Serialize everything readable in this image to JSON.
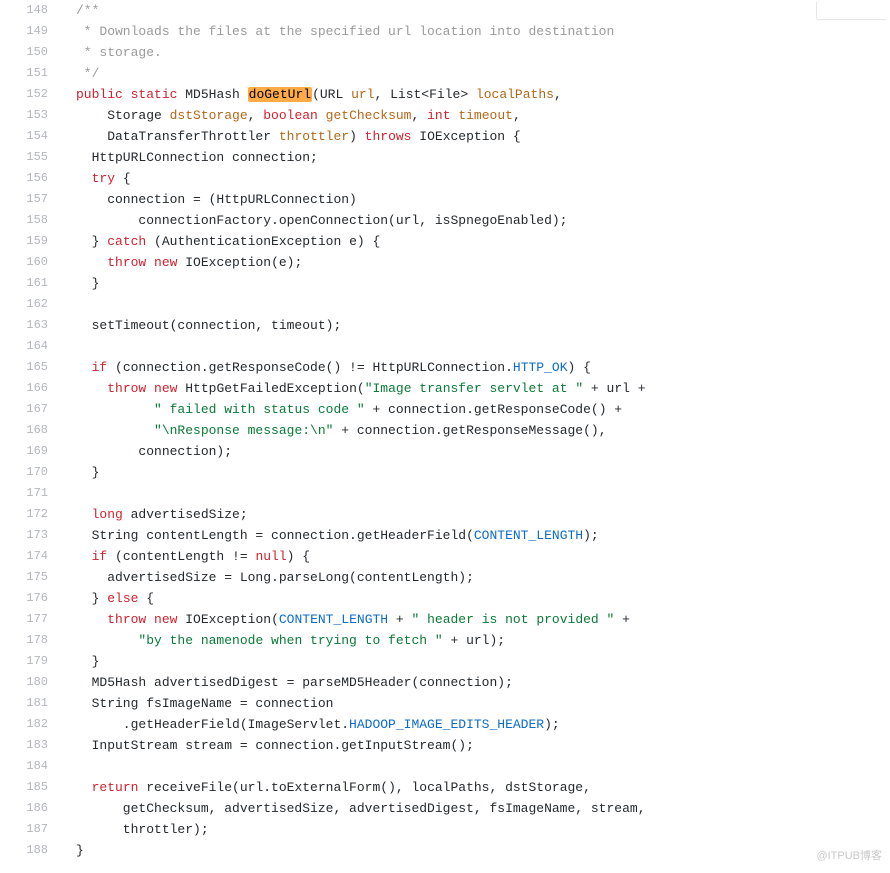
{
  "colors": {
    "kw": "#cf222e",
    "type": "#000000",
    "ident": "#b26818",
    "str": "#0a7b36",
    "const": "#0a6bcb",
    "comment": "#9b9b9b",
    "text": "#24292e"
  },
  "watermark": "@ITPUB博客",
  "code": [
    {
      "ln": 148,
      "tokens": [
        {
          "t": "/**",
          "c": "comment"
        }
      ]
    },
    {
      "ln": 149,
      "tokens": [
        {
          "t": " * Downloads the files at the specified url location into destination",
          "c": "comment"
        }
      ]
    },
    {
      "ln": 150,
      "tokens": [
        {
          "t": " * storage.",
          "c": "comment"
        }
      ]
    },
    {
      "ln": 151,
      "tokens": [
        {
          "t": " */",
          "c": "comment"
        }
      ]
    },
    {
      "ln": 152,
      "tokens": [
        {
          "t": "public",
          "c": "kw"
        },
        {
          "t": " "
        },
        {
          "t": "static",
          "c": "kw"
        },
        {
          "t": " MD5Hash "
        },
        {
          "t": "doGetUrl",
          "c": "text",
          "hl": true
        },
        {
          "t": "(URL "
        },
        {
          "t": "url",
          "c": "ident"
        },
        {
          "t": ", List<File> "
        },
        {
          "t": "localPaths",
          "c": "ident"
        },
        {
          "t": ","
        }
      ]
    },
    {
      "ln": 153,
      "tokens": [
        {
          "t": "    Storage "
        },
        {
          "t": "dstStorage",
          "c": "ident"
        },
        {
          "t": ", "
        },
        {
          "t": "boolean",
          "c": "kw"
        },
        {
          "t": " "
        },
        {
          "t": "getChecksum",
          "c": "ident"
        },
        {
          "t": ", "
        },
        {
          "t": "int",
          "c": "kw"
        },
        {
          "t": " "
        },
        {
          "t": "timeout",
          "c": "ident"
        },
        {
          "t": ","
        }
      ]
    },
    {
      "ln": 154,
      "tokens": [
        {
          "t": "    DataTransferThrottler "
        },
        {
          "t": "throttler",
          "c": "ident"
        },
        {
          "t": ") "
        },
        {
          "t": "throws",
          "c": "kw"
        },
        {
          "t": " IOException {"
        }
      ]
    },
    {
      "ln": 155,
      "tokens": [
        {
          "t": "  HttpURLConnection connection;"
        }
      ]
    },
    {
      "ln": 156,
      "tokens": [
        {
          "t": "  "
        },
        {
          "t": "try",
          "c": "kw"
        },
        {
          "t": " {"
        }
      ]
    },
    {
      "ln": 157,
      "tokens": [
        {
          "t": "    connection = (HttpURLConnection)"
        }
      ]
    },
    {
      "ln": 158,
      "tokens": [
        {
          "t": "        connectionFactory.openConnection(url, isSpnegoEnabled);"
        }
      ]
    },
    {
      "ln": 159,
      "tokens": [
        {
          "t": "  } "
        },
        {
          "t": "catch",
          "c": "kw"
        },
        {
          "t": " (AuthenticationException e) {"
        }
      ]
    },
    {
      "ln": 160,
      "tokens": [
        {
          "t": "    "
        },
        {
          "t": "throw",
          "c": "kw"
        },
        {
          "t": " "
        },
        {
          "t": "new",
          "c": "kw"
        },
        {
          "t": " IOException(e);"
        }
      ]
    },
    {
      "ln": 161,
      "tokens": [
        {
          "t": "  }"
        }
      ]
    },
    {
      "ln": 162,
      "tokens": []
    },
    {
      "ln": 163,
      "tokens": [
        {
          "t": "  setTimeout(connection, timeout);"
        }
      ]
    },
    {
      "ln": 164,
      "tokens": []
    },
    {
      "ln": 165,
      "tokens": [
        {
          "t": "  "
        },
        {
          "t": "if",
          "c": "kw"
        },
        {
          "t": " (connection.getResponseCode() != HttpURLConnection."
        },
        {
          "t": "HTTP_OK",
          "c": "const"
        },
        {
          "t": ") {"
        }
      ]
    },
    {
      "ln": 166,
      "tokens": [
        {
          "t": "    "
        },
        {
          "t": "throw",
          "c": "kw"
        },
        {
          "t": " "
        },
        {
          "t": "new",
          "c": "kw"
        },
        {
          "t": " HttpGetFailedException("
        },
        {
          "t": "\"Image transfer servlet at \"",
          "c": "str"
        },
        {
          "t": " + url +"
        }
      ]
    },
    {
      "ln": 167,
      "tokens": [
        {
          "t": "          "
        },
        {
          "t": "\" failed with status code \"",
          "c": "str"
        },
        {
          "t": " + connection.getResponseCode() +"
        }
      ]
    },
    {
      "ln": 168,
      "tokens": [
        {
          "t": "          "
        },
        {
          "t": "\"\\nResponse message:\\n\"",
          "c": "str"
        },
        {
          "t": " + connection.getResponseMessage(),"
        }
      ]
    },
    {
      "ln": 169,
      "tokens": [
        {
          "t": "        connection);"
        }
      ]
    },
    {
      "ln": 170,
      "tokens": [
        {
          "t": "  }"
        }
      ]
    },
    {
      "ln": 171,
      "tokens": []
    },
    {
      "ln": 172,
      "tokens": [
        {
          "t": "  "
        },
        {
          "t": "long",
          "c": "kw"
        },
        {
          "t": " advertisedSize;"
        }
      ]
    },
    {
      "ln": 173,
      "tokens": [
        {
          "t": "  String contentLength = connection.getHeaderField("
        },
        {
          "t": "CONTENT_LENGTH",
          "c": "const"
        },
        {
          "t": ");"
        }
      ]
    },
    {
      "ln": 174,
      "tokens": [
        {
          "t": "  "
        },
        {
          "t": "if",
          "c": "kw"
        },
        {
          "t": " (contentLength != "
        },
        {
          "t": "null",
          "c": "kw"
        },
        {
          "t": ") {"
        }
      ]
    },
    {
      "ln": 175,
      "tokens": [
        {
          "t": "    advertisedSize = Long.parseLong(contentLength);"
        }
      ]
    },
    {
      "ln": 176,
      "tokens": [
        {
          "t": "  } "
        },
        {
          "t": "else",
          "c": "kw"
        },
        {
          "t": " {"
        }
      ]
    },
    {
      "ln": 177,
      "tokens": [
        {
          "t": "    "
        },
        {
          "t": "throw",
          "c": "kw"
        },
        {
          "t": " "
        },
        {
          "t": "new",
          "c": "kw"
        },
        {
          "t": " IOException("
        },
        {
          "t": "CONTENT_LENGTH",
          "c": "const"
        },
        {
          "t": " + "
        },
        {
          "t": "\" header is not provided \"",
          "c": "str"
        },
        {
          "t": " +"
        }
      ]
    },
    {
      "ln": 178,
      "tokens": [
        {
          "t": "        "
        },
        {
          "t": "\"by the namenode when trying to fetch \"",
          "c": "str"
        },
        {
          "t": " + url);"
        }
      ]
    },
    {
      "ln": 179,
      "tokens": [
        {
          "t": "  }"
        }
      ]
    },
    {
      "ln": 180,
      "tokens": [
        {
          "t": "  MD5Hash advertisedDigest = parseMD5Header(connection);"
        }
      ]
    },
    {
      "ln": 181,
      "tokens": [
        {
          "t": "  String fsImageName = connection"
        }
      ]
    },
    {
      "ln": 182,
      "tokens": [
        {
          "t": "      .getHeaderField(ImageServlet."
        },
        {
          "t": "HADOOP_IMAGE_EDITS_HEADER",
          "c": "const"
        },
        {
          "t": ");"
        }
      ]
    },
    {
      "ln": 183,
      "tokens": [
        {
          "t": "  InputStream stream = connection.getInputStream();"
        }
      ]
    },
    {
      "ln": 184,
      "tokens": []
    },
    {
      "ln": 185,
      "tokens": [
        {
          "t": "  "
        },
        {
          "t": "return",
          "c": "kw"
        },
        {
          "t": " receiveFile(url.toExternalForm(), localPaths, dstStorage,"
        }
      ]
    },
    {
      "ln": 186,
      "tokens": [
        {
          "t": "      getChecksum, advertisedSize, advertisedDigest, fsImageName, stream,"
        }
      ]
    },
    {
      "ln": 187,
      "tokens": [
        {
          "t": "      throttler);"
        }
      ]
    },
    {
      "ln": 188,
      "tokens": [
        {
          "t": "}"
        }
      ]
    }
  ]
}
